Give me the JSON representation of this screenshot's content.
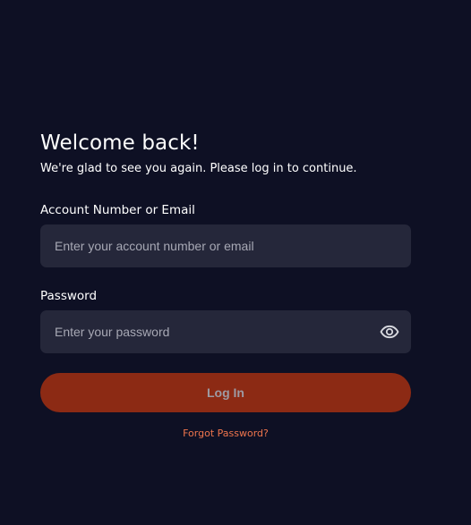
{
  "colors": {
    "background": "#0e1024",
    "input_background": "#25273a",
    "button_background": "#8c2a14",
    "link": "#ef754d"
  },
  "login": {
    "title": "Welcome back!",
    "subtitle": "We're glad to see you again. Please log in to continue.",
    "account_label": "Account Number or Email",
    "account_placeholder": "Enter your account number or email",
    "account_value": "",
    "password_label": "Password",
    "password_placeholder": "Enter your password",
    "password_value": "",
    "toggle_icon": "eye-icon",
    "login_button_label": "Log In",
    "forgot_password_label": "Forgot Password?"
  }
}
